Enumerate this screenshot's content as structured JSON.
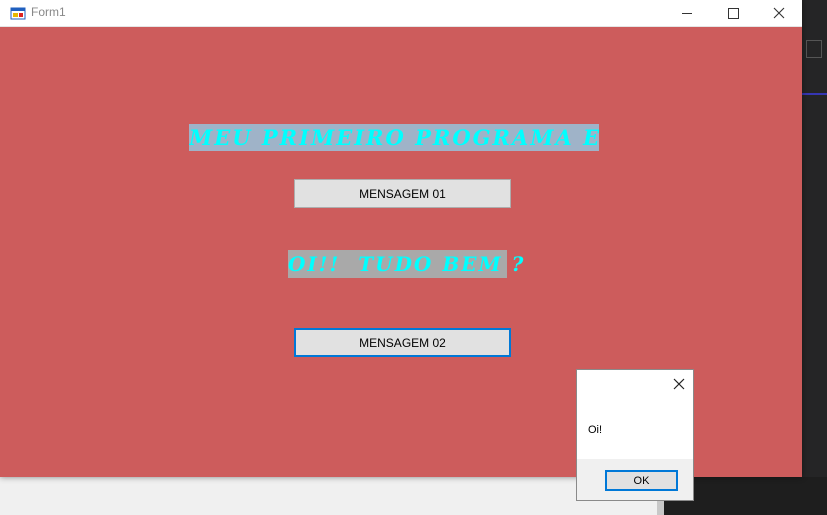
{
  "window": {
    "title": "Form1",
    "background_color": "#cd5c5c"
  },
  "form": {
    "heading": "MEU PRIMEIRO PROGRAMA EM C#",
    "button1_label": "MENSAGEM 01",
    "subheading": "OI!!  TUDO BEM ?",
    "button2_label": "MENSAGEM 02",
    "text_color": "#00ffff"
  },
  "messagebox": {
    "text": "Oi!",
    "ok_label": "OK"
  }
}
